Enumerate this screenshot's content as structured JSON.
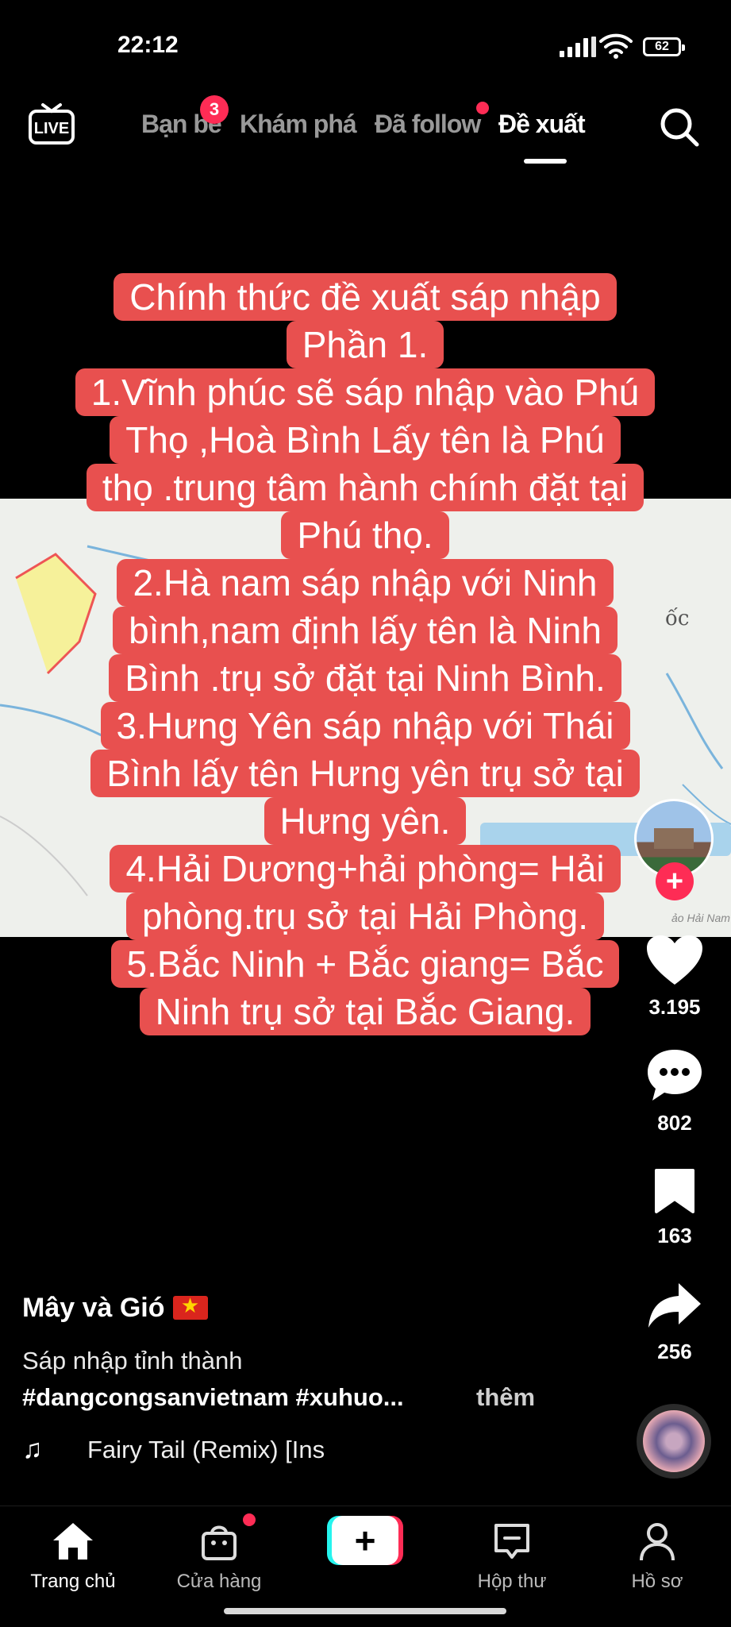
{
  "status_bar": {
    "time": "22:12",
    "battery": "62"
  },
  "top_nav": {
    "live_label": "LIVE",
    "tabs": [
      {
        "label": "Bạn bè",
        "badge": "3"
      },
      {
        "label": "Khám phá"
      },
      {
        "label": "Đã follow",
        "has_dot": true
      },
      {
        "label": "Đề xuất",
        "active": true
      }
    ]
  },
  "video": {
    "map_label": "ốc",
    "map_credit": "ảo Hải Nam",
    "caption_lines": [
      "Chính thức đề xuất sáp nhập",
      "Phần 1.",
      "1.Vĩnh phúc sẽ sáp nhập vào Phú",
      "Thọ ,Hoà Bình Lấy tên là Phú",
      "thọ .trung tâm hành chính đặt tại",
      "Phú thọ.",
      "2.Hà nam sáp nhập với Ninh",
      "bình,nam định lấy tên là Ninh",
      "Bình .trụ sở đặt tại Ninh Bình.",
      "3.Hưng Yên sáp nhập với Thái",
      "Bình lấy tên Hưng yên trụ sở tại",
      "Hưng yên.",
      "4.Hải Dương+hải phòng= Hải",
      "phòng.trụ sở tại Hải Phòng.",
      "5.Bắc Ninh + Bắc giang= Bắc",
      "Ninh trụ sở tại Bắc Giang."
    ]
  },
  "right_rail": {
    "likes": "3.195",
    "comments": "802",
    "saves": "163",
    "shares": "256"
  },
  "post": {
    "author": "Mây và Gió",
    "description": "Sáp nhập tỉnh thành",
    "hashtags": "#dangcongsanvietnam #xuhuo...",
    "more": "thêm",
    "music_note": "♫",
    "music": "Fairy Tail (Remix) [Ins"
  },
  "bottom_nav": {
    "items": [
      {
        "label": "Trang chủ",
        "active": true
      },
      {
        "label": "Cửa hàng",
        "has_dot": true
      },
      {
        "label": "+"
      },
      {
        "label": "Hộp thư"
      },
      {
        "label": "Hồ sơ"
      }
    ]
  },
  "colors": {
    "accent": "#fe2c55",
    "caption_bg": "#e8504f",
    "cyan": "#25f4ee"
  }
}
